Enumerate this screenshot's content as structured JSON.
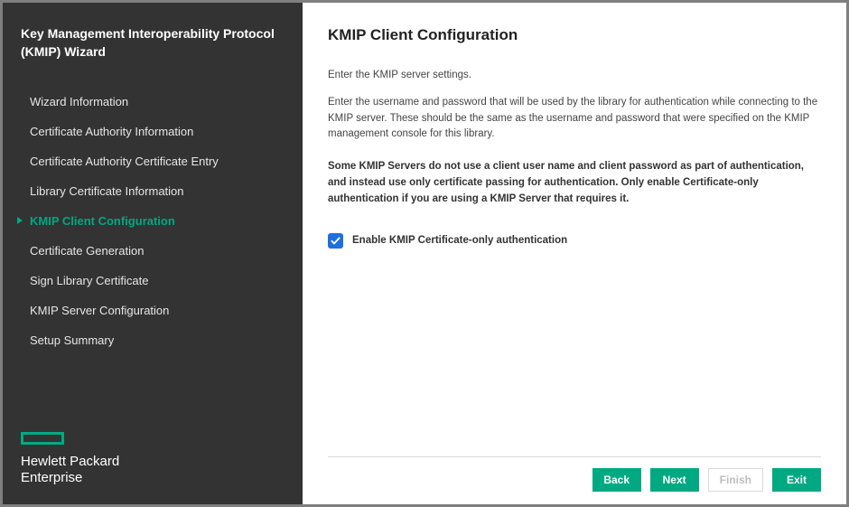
{
  "colors": {
    "accent": "#01a982",
    "checkbox_bg": "#1f6fde",
    "sidebar_bg": "#333333",
    "window_border": "#7f7f7f"
  },
  "sidebar": {
    "title": "Key Management Interoperability Protocol (KMIP) Wizard",
    "items": [
      {
        "label": "Wizard Information",
        "active": false
      },
      {
        "label": "Certificate Authority Information",
        "active": false
      },
      {
        "label": "Certificate Authority Certificate Entry",
        "active": false
      },
      {
        "label": "Library Certificate Information",
        "active": false
      },
      {
        "label": "KMIP Client Configuration",
        "active": true
      },
      {
        "label": "Certificate Generation",
        "active": false
      },
      {
        "label": "Sign Library Certificate",
        "active": false
      },
      {
        "label": "KMIP Server Configuration",
        "active": false
      },
      {
        "label": "Setup Summary",
        "active": false
      }
    ],
    "logo_line1": "Hewlett Packard",
    "logo_line2": "Enterprise"
  },
  "main": {
    "title": "KMIP Client Configuration",
    "para1": "Enter the KMIP server settings.",
    "para2": "Enter the username and password that will be used by the library for authentication while connecting to the KMIP server. These should be the same as the username and password that were specified on the KMIP management console for this library.",
    "para3": "Some KMIP Servers do not use a client user name and client password as part of authentication, and instead use only certificate passing for authentication. Only enable Certificate-only authentication if you are using a KMIP Server that requires it.",
    "checkbox_label": "Enable KMIP Certificate-only authentication",
    "checkbox_checked": true
  },
  "footer": {
    "back": "Back",
    "next": "Next",
    "finish": "Finish",
    "exit": "Exit",
    "finish_enabled": false
  }
}
